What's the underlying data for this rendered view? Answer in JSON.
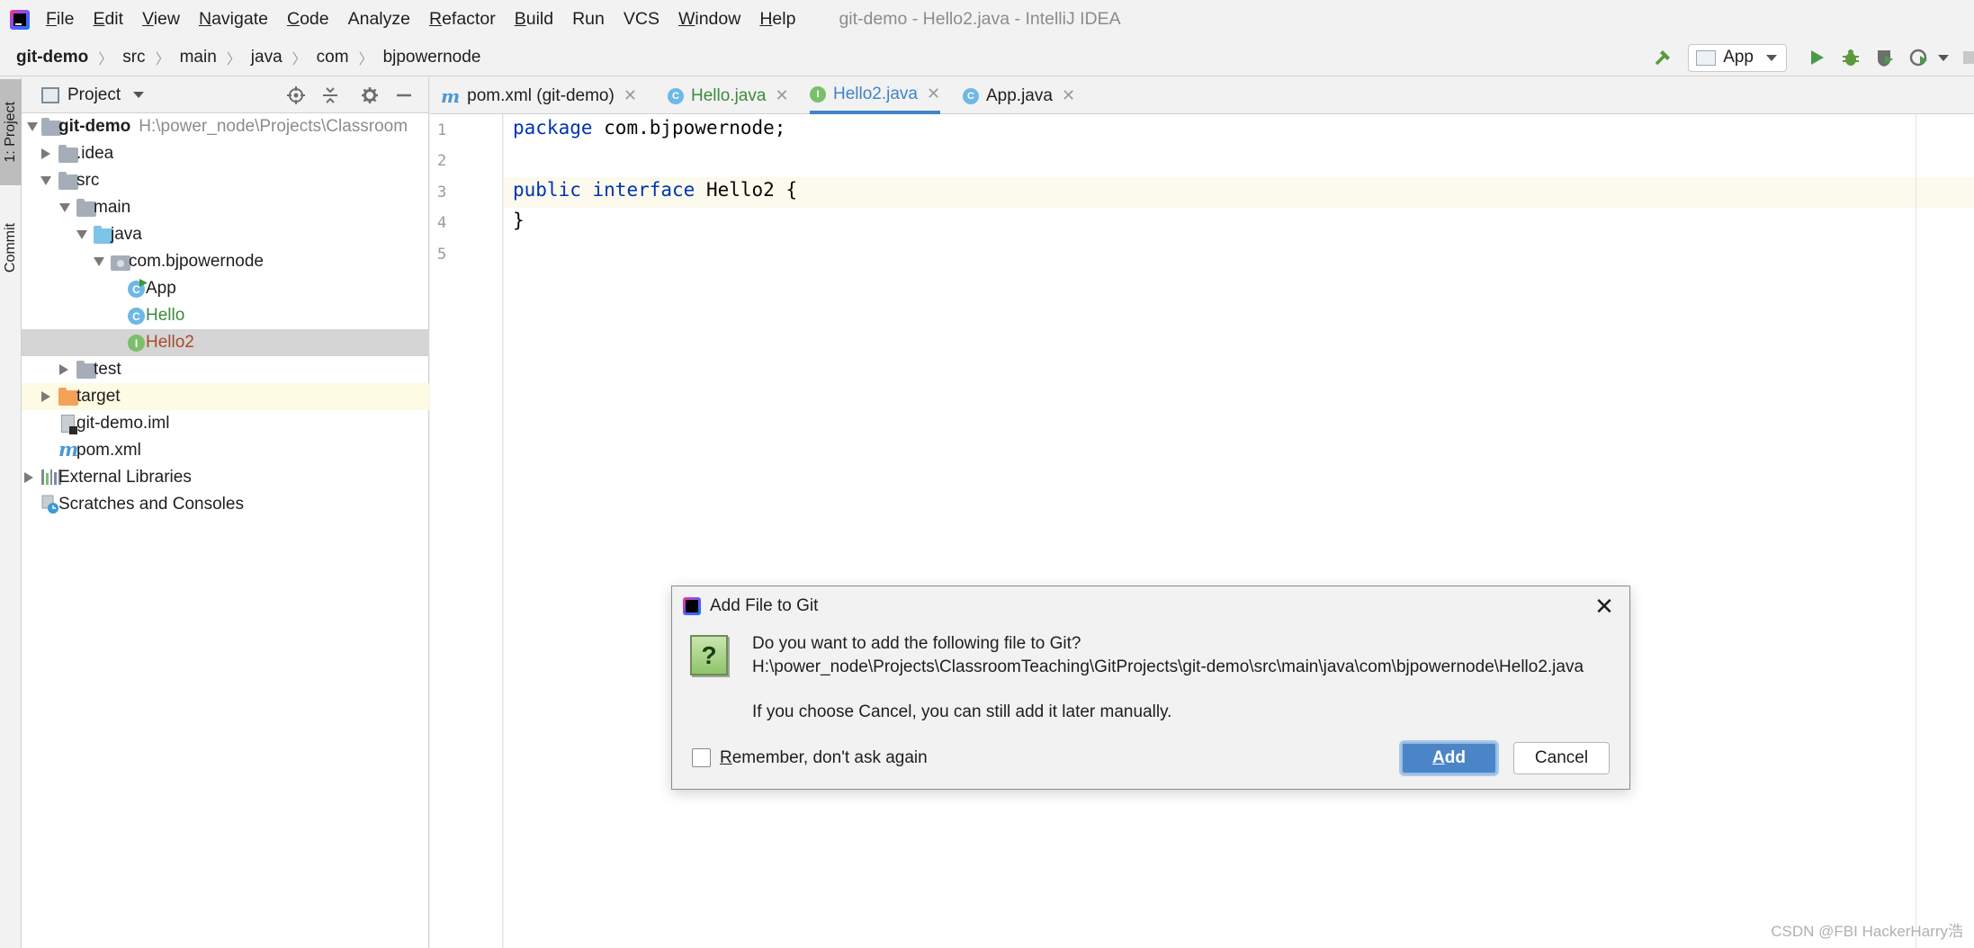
{
  "menubar": {
    "items": [
      {
        "mnemonic": "F",
        "rest": "ile"
      },
      {
        "mnemonic": "E",
        "rest": "dit"
      },
      {
        "mnemonic": "V",
        "rest": "iew"
      },
      {
        "mnemonic": "N",
        "rest": "avigate"
      },
      {
        "mnemonic": "C",
        "rest": "ode"
      },
      {
        "mnemonic": "",
        "rest": "Analyze"
      },
      {
        "mnemonic": "R",
        "rest": "efactor"
      },
      {
        "mnemonic": "B",
        "rest": "uild"
      },
      {
        "mnemonic": "",
        "rest": "Run"
      },
      {
        "mnemonic": "",
        "rest": "VCS"
      },
      {
        "mnemonic": "W",
        "rest": "indow"
      },
      {
        "mnemonic": "H",
        "rest": "elp"
      }
    ],
    "window_title": "git-demo - Hello2.java - IntelliJ IDEA"
  },
  "breadcrumb": [
    "git-demo",
    "src",
    "main",
    "java",
    "com",
    "bjpowernode"
  ],
  "toolbar": {
    "run_config": "App"
  },
  "left_stripe": {
    "project_tab": "1: Project",
    "commit_tab": "Commit"
  },
  "project_panel": {
    "title": "Project",
    "tree": [
      {
        "label": "git-demo",
        "path": "H:\\power_node\\Projects\\Classroom"
      },
      {
        "label": ".idea"
      },
      {
        "label": "src"
      },
      {
        "label": "main"
      },
      {
        "label": "java"
      },
      {
        "label": "com.bjpowernode"
      },
      {
        "label": "App"
      },
      {
        "label": "Hello"
      },
      {
        "label": "Hello2"
      },
      {
        "label": "test"
      },
      {
        "label": "target"
      },
      {
        "label": "git-demo.iml"
      },
      {
        "label": "pom.xml"
      },
      {
        "label": "External Libraries"
      },
      {
        "label": "Scratches and Consoles"
      }
    ]
  },
  "editor": {
    "tabs": [
      {
        "label": "pom.xml (git-demo)",
        "icon": "maven-icon"
      },
      {
        "label": "Hello.java",
        "icon": "class-icon"
      },
      {
        "label": "Hello2.java",
        "icon": "interface-icon"
      },
      {
        "label": "App.java",
        "icon": "class-icon"
      }
    ],
    "active_tab": "Hello2.java",
    "line_numbers": [
      "1",
      "2",
      "3",
      "4",
      "5"
    ],
    "code": {
      "line1_kw": "package",
      "line1_rest": " com.bjpowernode;",
      "line3_kw1": "public",
      "line3_kw2": "interface",
      "line3_rest": " Hello2 {",
      "line4": "}"
    }
  },
  "dialog": {
    "title": "Add File to Git",
    "question": "Do you want to add the following file to Git?",
    "file_path": "H:\\power_node\\Projects\\ClassroomTeaching\\GitProjects\\git-demo\\src\\main\\java\\com\\bjpowernode\\Hello2.java",
    "note": "If you choose Cancel, you can still add it later manually.",
    "remember_mnemonic": "R",
    "remember_rest": "emember, don't ask again",
    "add_mnemonic": "A",
    "add_rest": "dd",
    "cancel_label": "Cancel",
    "remember_checked": false
  },
  "watermark": "CSDN @FBI HackerHarry浩",
  "colors": {
    "accent": "#4083c9",
    "keyword": "#0033b3",
    "add_button": "#4a86c7",
    "selected_row": "#d5d5d5",
    "caret_line": "#fcfaed"
  }
}
